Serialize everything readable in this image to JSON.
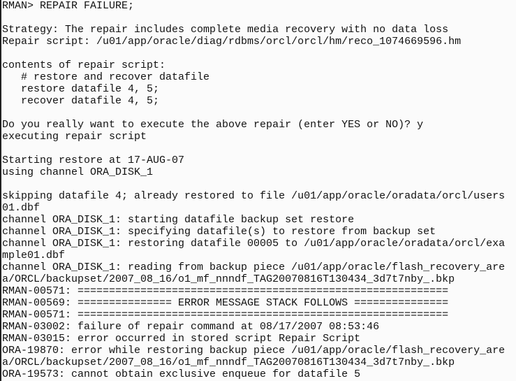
{
  "terminal": {
    "lines": [
      "RMAN> REPAIR FAILURE;",
      "",
      "Strategy: The repair includes complete media recovery with no data loss",
      "Repair script: /u01/app/oracle/diag/rdbms/orcl/orcl/hm/reco_1074669596.hm",
      "",
      "contents of repair script:",
      "   # restore and recover datafile",
      "   restore datafile 4, 5;",
      "   recover datafile 4, 5;",
      "",
      "Do you really want to execute the above repair (enter YES or NO)? y",
      "executing repair script",
      "",
      "Starting restore at 17-AUG-07",
      "using channel ORA_DISK_1",
      "",
      "skipping datafile 4; already restored to file /u01/app/oracle/oradata/orcl/users",
      "01.dbf",
      "channel ORA_DISK_1: starting datafile backup set restore",
      "channel ORA_DISK_1: specifying datafile(s) to restore from backup set",
      "channel ORA_DISK_1: restoring datafile 00005 to /u01/app/oracle/oradata/orcl/exa",
      "mple01.dbf",
      "channel ORA_DISK_1: reading from backup piece /u01/app/oracle/flash_recovery_are",
      "a/ORCL/backupset/2007_08_16/o1_mf_nnndf_TAG20070816T130434_3d7t7nby_.bkp",
      "RMAN-00571: ===========================================================",
      "RMAN-00569: =============== ERROR MESSAGE STACK FOLLOWS ===============",
      "RMAN-00571: ===========================================================",
      "RMAN-03002: failure of repair command at 08/17/2007 08:53:46",
      "RMAN-03015: error occurred in stored script Repair Script",
      "ORA-19870: error while restoring backup piece /u01/app/oracle/flash_recovery_are",
      "a/ORCL/backupset/2007_08_16/o1_mf_nnndf_TAG20070816T130434_3d7t7nby_.bkp",
      "ORA-19573: cannot obtain exclusive enqueue for datafile 5"
    ]
  }
}
